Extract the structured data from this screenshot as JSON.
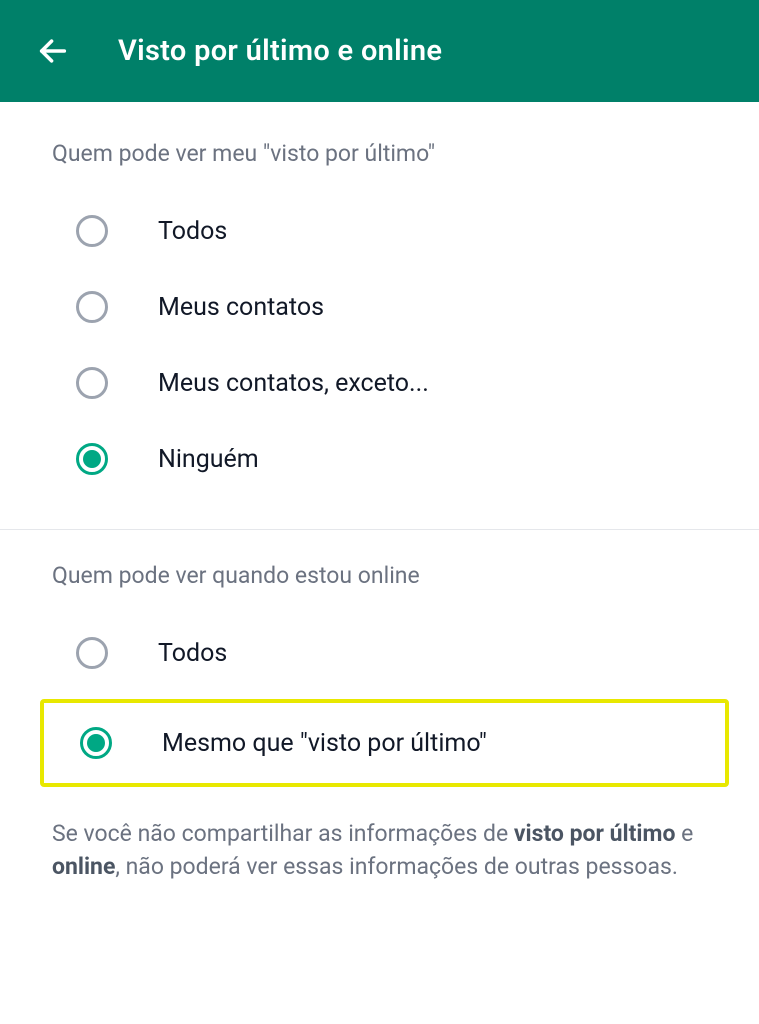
{
  "header": {
    "title": "Visto por último e online"
  },
  "section1": {
    "title": "Quem pode ver meu \"visto por último\"",
    "options": [
      {
        "label": "Todos",
        "selected": false
      },
      {
        "label": "Meus contatos",
        "selected": false
      },
      {
        "label": "Meus contatos, exceto...",
        "selected": false
      },
      {
        "label": "Ninguém",
        "selected": true
      }
    ]
  },
  "section2": {
    "title": "Quem pode ver quando estou online",
    "options": [
      {
        "label": "Todos",
        "selected": false
      },
      {
        "label": "Mesmo que \"visto por último\"",
        "selected": true
      }
    ]
  },
  "footer": {
    "prefix": "Se você não compartilhar as informações de ",
    "bold1": "visto por último",
    "mid": " e ",
    "bold2": "online",
    "suffix": ", não poderá ver essas informações de outras pessoas."
  }
}
